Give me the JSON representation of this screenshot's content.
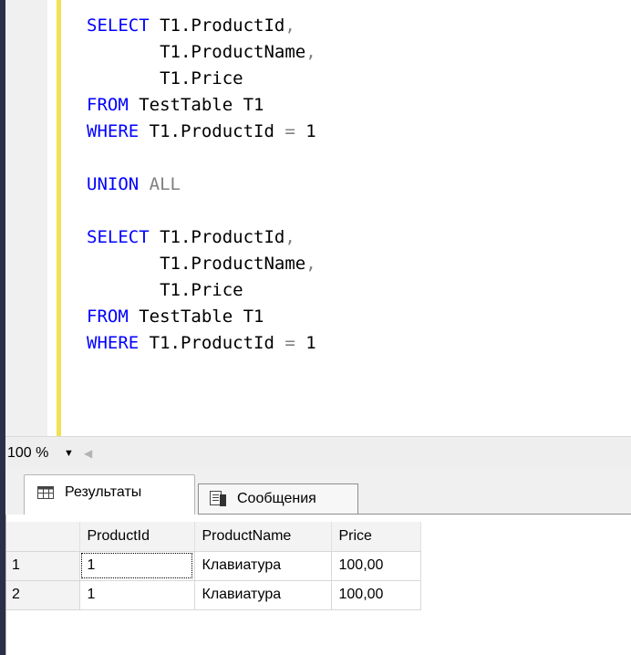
{
  "editor": {
    "lines": [
      {
        "parts": [
          {
            "t": "SELECT ",
            "c": "kw"
          },
          {
            "t": "T1.ProductId",
            "c": ""
          },
          {
            "t": ",",
            "c": "gray"
          }
        ]
      },
      {
        "parts": [
          {
            "t": "       T1.ProductName",
            "c": ""
          },
          {
            "t": ",",
            "c": "gray"
          }
        ]
      },
      {
        "parts": [
          {
            "t": "       T1.Price",
            "c": ""
          }
        ]
      },
      {
        "parts": [
          {
            "t": "FROM ",
            "c": "kw"
          },
          {
            "t": "TestTable T1",
            "c": ""
          }
        ]
      },
      {
        "parts": [
          {
            "t": "WHERE ",
            "c": "kw"
          },
          {
            "t": "T1.ProductId ",
            "c": ""
          },
          {
            "t": "=",
            "c": "gray"
          },
          {
            "t": " 1",
            "c": ""
          }
        ]
      },
      {
        "parts": []
      },
      {
        "parts": [
          {
            "t": "UNION ",
            "c": "kw"
          },
          {
            "t": "ALL",
            "c": "gray"
          }
        ]
      },
      {
        "parts": []
      },
      {
        "parts": [
          {
            "t": "SELECT ",
            "c": "kw"
          },
          {
            "t": "T1.ProductId",
            "c": ""
          },
          {
            "t": ",",
            "c": "gray"
          }
        ]
      },
      {
        "parts": [
          {
            "t": "       T1.ProductName",
            "c": ""
          },
          {
            "t": ",",
            "c": "gray"
          }
        ]
      },
      {
        "parts": [
          {
            "t": "       T1.Price",
            "c": ""
          }
        ]
      },
      {
        "parts": [
          {
            "t": "FROM ",
            "c": "kw"
          },
          {
            "t": "TestTable T1",
            "c": ""
          }
        ]
      },
      {
        "parts": [
          {
            "t": "WHERE ",
            "c": "kw"
          },
          {
            "t": "T1.ProductId ",
            "c": ""
          },
          {
            "t": "=",
            "c": "gray"
          },
          {
            "t": " 1",
            "c": ""
          }
        ]
      }
    ],
    "keyword_color": "#0000ff",
    "operator_color": "#808080",
    "change_bar_color": "#f2e055"
  },
  "zoom": {
    "value": "100 %"
  },
  "results": {
    "tabs": [
      {
        "label": "Результаты",
        "icon": "grid-icon",
        "active": true
      },
      {
        "label": "Сообщения",
        "icon": "messages-icon",
        "active": false
      }
    ],
    "columns": [
      "ProductId",
      "ProductName",
      "Price"
    ],
    "rows": [
      {
        "num": "1",
        "cells": [
          "1",
          "Клавиатура",
          "100,00"
        ]
      },
      {
        "num": "2",
        "cells": [
          "1",
          "Клавиатура",
          "100,00"
        ]
      }
    ]
  }
}
